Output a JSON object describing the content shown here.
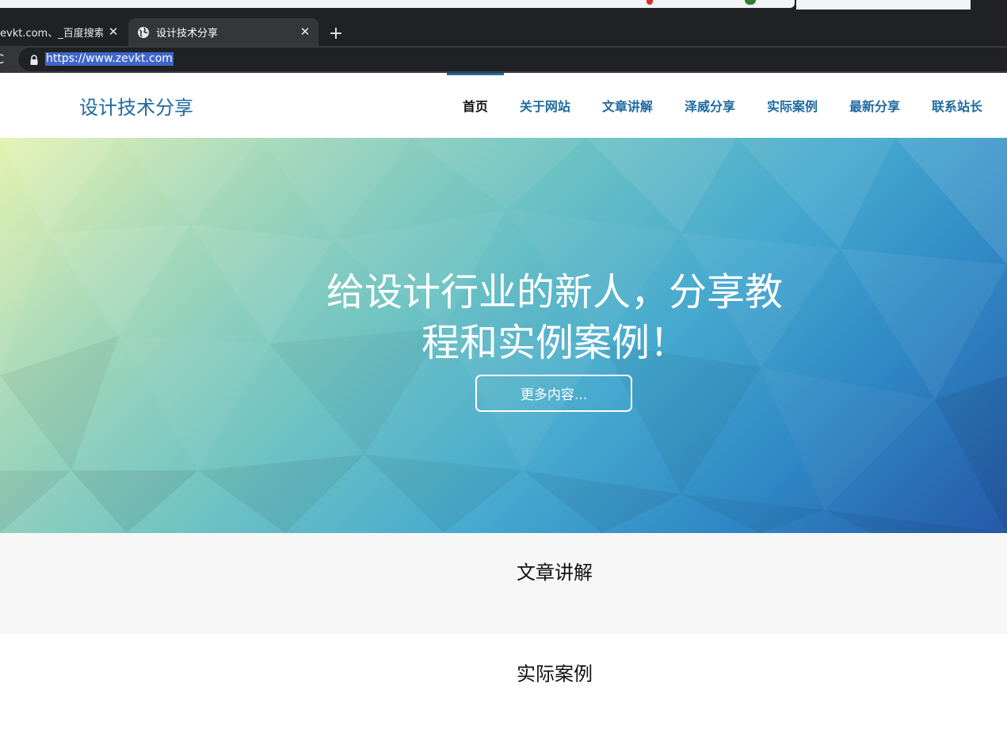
{
  "browser": {
    "tabs": [
      {
        "title": "evkt.com、_百度搜索",
        "active": false
      },
      {
        "title": "设计技术分享",
        "active": true
      }
    ],
    "new_tab_symbol": "+",
    "close_symbol": "✕",
    "reload_symbol": "C",
    "url": "https://www.zevkt.com",
    "icons": [
      "globe-icon",
      "lock-icon",
      "close-icon",
      "plus-icon",
      "reload-icon"
    ]
  },
  "site": {
    "logo": "设计技术分享",
    "nav": [
      {
        "label": "首页",
        "active": true
      },
      {
        "label": "关于网站",
        "active": false
      },
      {
        "label": "文章讲解",
        "active": false
      },
      {
        "label": "泽威分享",
        "active": false
      },
      {
        "label": "实际案例",
        "active": false
      },
      {
        "label": "最新分享",
        "active": false
      },
      {
        "label": "联系站长",
        "active": false
      }
    ]
  },
  "hero": {
    "title_line1": "给设计行业的新人，分享教",
    "title_line2": "程和实例案例！",
    "button": "更多内容..."
  },
  "sections": [
    {
      "title": "文章讲解"
    },
    {
      "title": "实际案例"
    }
  ],
  "colors": {
    "brand": "#1f6aa0",
    "chrome_dark": "#202124",
    "url_highlight": "#3e67c9"
  }
}
